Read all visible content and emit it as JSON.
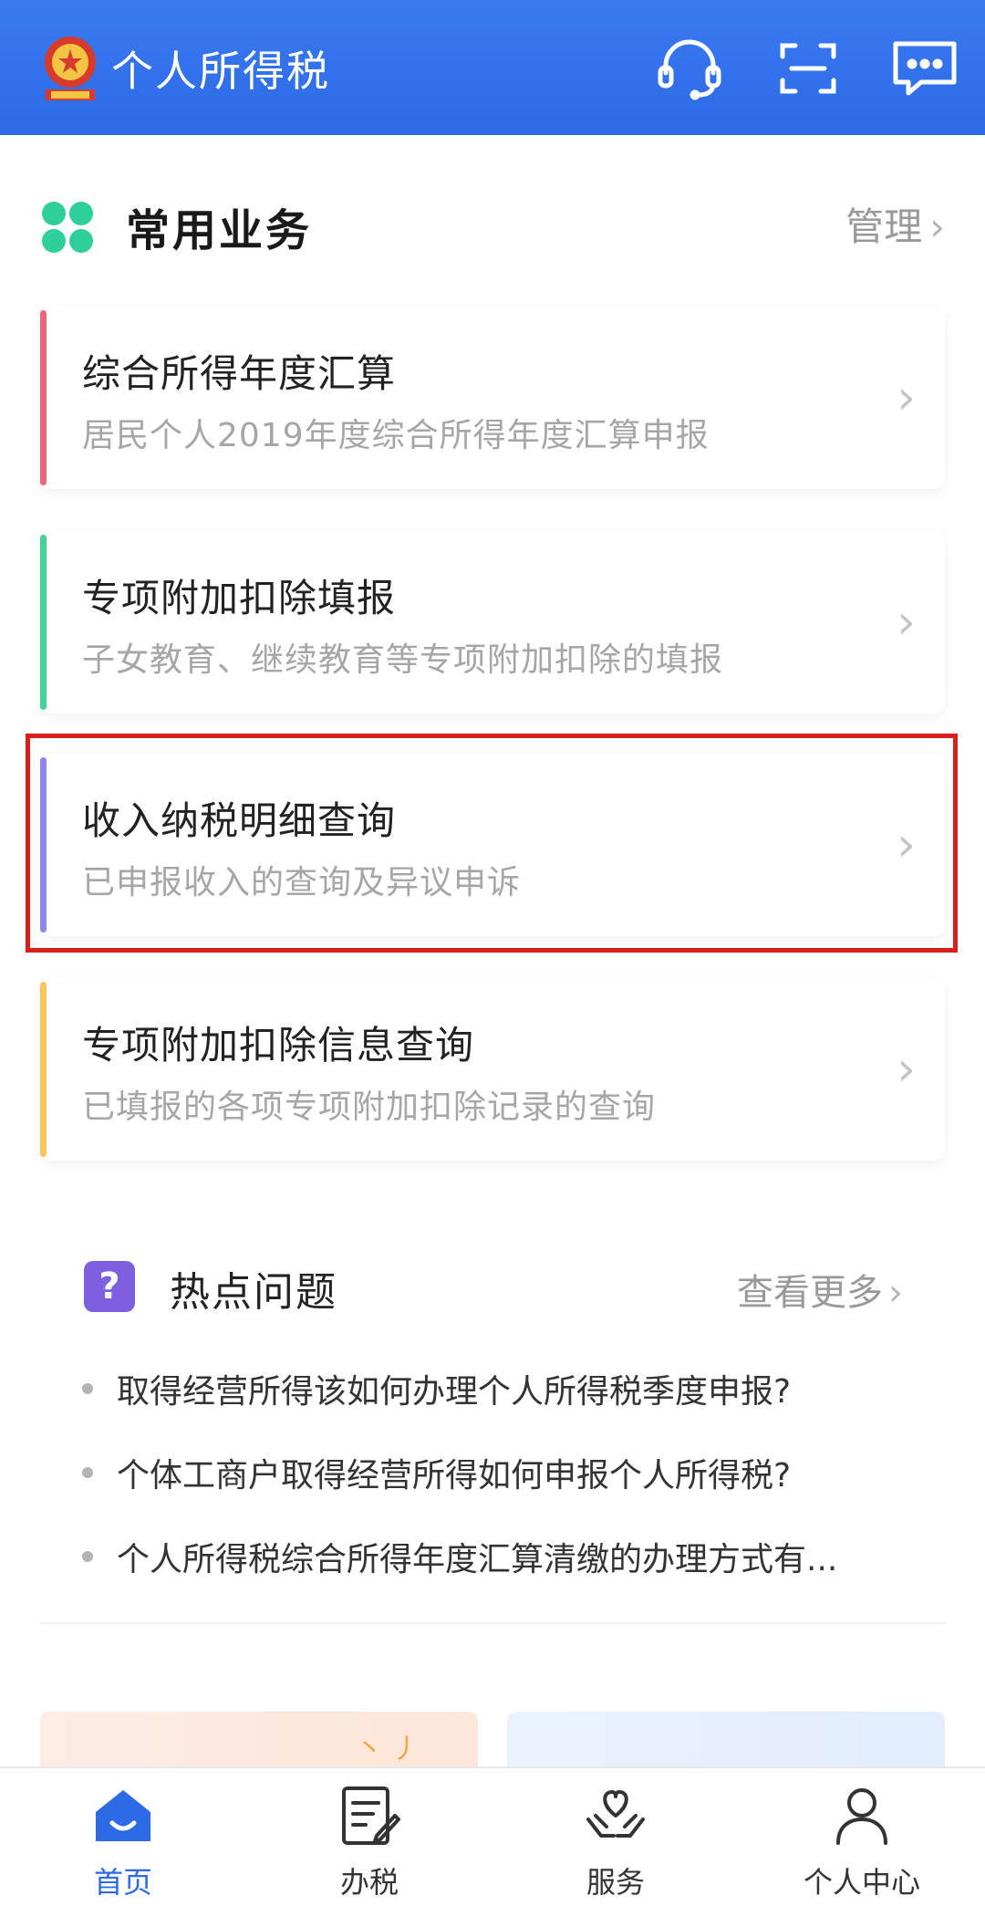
{
  "header": {
    "title": "个人所得税",
    "icons": [
      "headset-icon",
      "scan-icon",
      "message-icon"
    ]
  },
  "common_services": {
    "title": "常用业务",
    "manage_label": "管理",
    "items": [
      {
        "title": "综合所得年度汇算",
        "subtitle": "居民个人2019年度综合所得年度汇算申报",
        "accent": "#e8677a"
      },
      {
        "title": "专项附加扣除填报",
        "subtitle": "子女教育、继续教育等专项附加扣除的填报",
        "accent": "#47d19a"
      },
      {
        "title": "收入纳税明细查询",
        "subtitle": "已申报收入的查询及异议申诉",
        "accent": "#8f86e6"
      },
      {
        "title": "专项附加扣除信息查询",
        "subtitle": "已填报的各项专项附加扣除记录的查询",
        "accent": "#f5c75a"
      }
    ],
    "highlight_color": "#d9201f"
  },
  "hot_questions": {
    "title": "热点问题",
    "more_label": "查看更多",
    "items": [
      "取得经营所得该如何办理个人所得税季度申报?",
      "个体工商户取得经营所得如何申报个人所得税?",
      "个人所得税综合所得年度汇算清缴的办理方式有..."
    ]
  },
  "bottom_nav": {
    "items": [
      {
        "label": "首页",
        "icon": "home-icon",
        "active": true
      },
      {
        "label": "办税",
        "icon": "tax-form-icon",
        "active": false
      },
      {
        "label": "服务",
        "icon": "heart-hands-icon",
        "active": false
      },
      {
        "label": "个人中心",
        "icon": "person-icon",
        "active": false
      }
    ]
  },
  "colors": {
    "brand": "#2d6ae6",
    "highlight": "#d9201f"
  }
}
